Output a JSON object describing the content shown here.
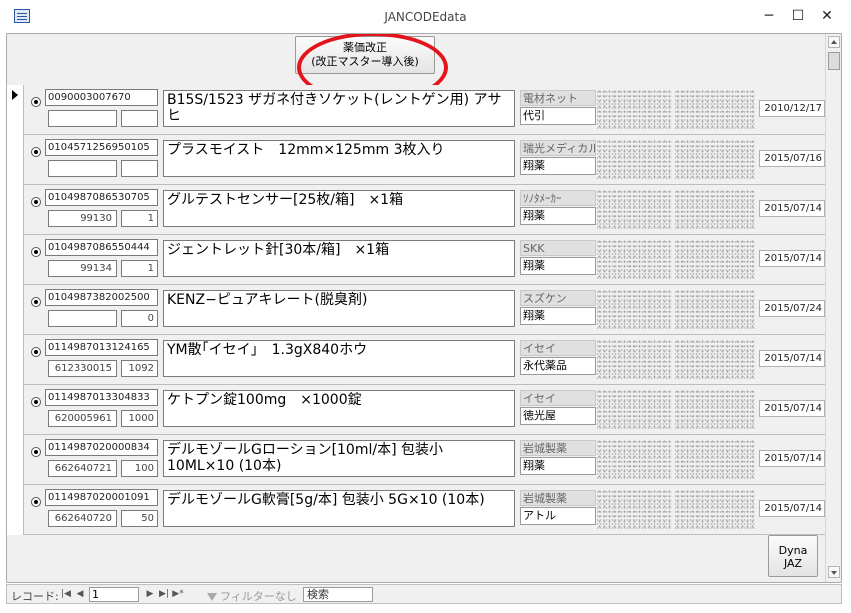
{
  "window": {
    "title": "JANCODEdata",
    "icon": "access-form-icon",
    "minimize": "─",
    "maximize": "☐",
    "close": "✕"
  },
  "header": {
    "revise_button": "薬価改正\n(改正マスター導入後)"
  },
  "rows": [
    {
      "jan": "0090003007670",
      "code1": "",
      "code2": "",
      "name": "B15S/1523 ザガネ付きソケット(レントゲン用) アサヒ",
      "maker": "電材ネット",
      "seller": "代引",
      "date": "2010/12/17",
      "current": true
    },
    {
      "jan": "0104571256950105",
      "code1": "",
      "code2": "",
      "name": "プラスモイスト　12mm×125mm 3枚入り",
      "maker": "瑞光メディカル",
      "seller": "翔薬",
      "date": "2015/07/16",
      "current": false
    },
    {
      "jan": "0104987086530705",
      "code1": "99130",
      "code2": "1",
      "name": "グルテストセンサー[25枚/箱]　×1箱",
      "maker": "ｿﾉﾀﾒｰｶｰ",
      "seller": "翔薬",
      "date": "2015/07/14",
      "current": false
    },
    {
      "jan": "0104987086550444",
      "code1": "99134",
      "code2": "1",
      "name": "ジェントレット針[30本/箱]　×1箱",
      "maker": "SKK",
      "seller": "翔薬",
      "date": "2015/07/14",
      "current": false
    },
    {
      "jan": "0104987382002500",
      "code1": "",
      "code2": "0",
      "name": "KENZ−ピュアキレート(脱臭剤)",
      "maker": "スズケン",
      "seller": "翔薬",
      "date": "2015/07/24",
      "current": false
    },
    {
      "jan": "0114987013124165",
      "code1": "612330015",
      "code2": "1092",
      "name": "YM散｢イセイ｣　1.3gX840ホウ",
      "maker": "イセイ",
      "seller": "永代薬品",
      "date": "2015/07/14",
      "current": false
    },
    {
      "jan": "0114987013304833",
      "code1": "620005961",
      "code2": "1000",
      "name": "ケトプン錠100mg　×1000錠",
      "maker": "イセイ",
      "seller": "徳光屋",
      "date": "2015/07/14",
      "current": false
    },
    {
      "jan": "0114987020000834",
      "code1": "662640721",
      "code2": "100",
      "name": "デルモゾールGローション[10ml/本] 包装小 10ML×10 (10本)",
      "maker": "岩城製薬",
      "seller": "翔薬",
      "date": "2015/07/14",
      "current": false
    },
    {
      "jan": "0114987020001091",
      "code1": "662640720",
      "code2": "50",
      "name": "デルモゾールG軟膏[5g/本] 包装小 5G×10 (10本)",
      "maker": "岩城製薬",
      "seller": "アトル",
      "date": "2015/07/14",
      "current": false
    }
  ],
  "footer": {
    "dyna_button": "Dyna\nJAZ"
  },
  "navigator": {
    "label": "レコード:",
    "first": "|◀",
    "prev": "◀",
    "current_record": "1",
    "next": "▶",
    "last": "▶|",
    "new": "▶*",
    "filter": "フィルターなし",
    "search_placeholder": "検索"
  }
}
